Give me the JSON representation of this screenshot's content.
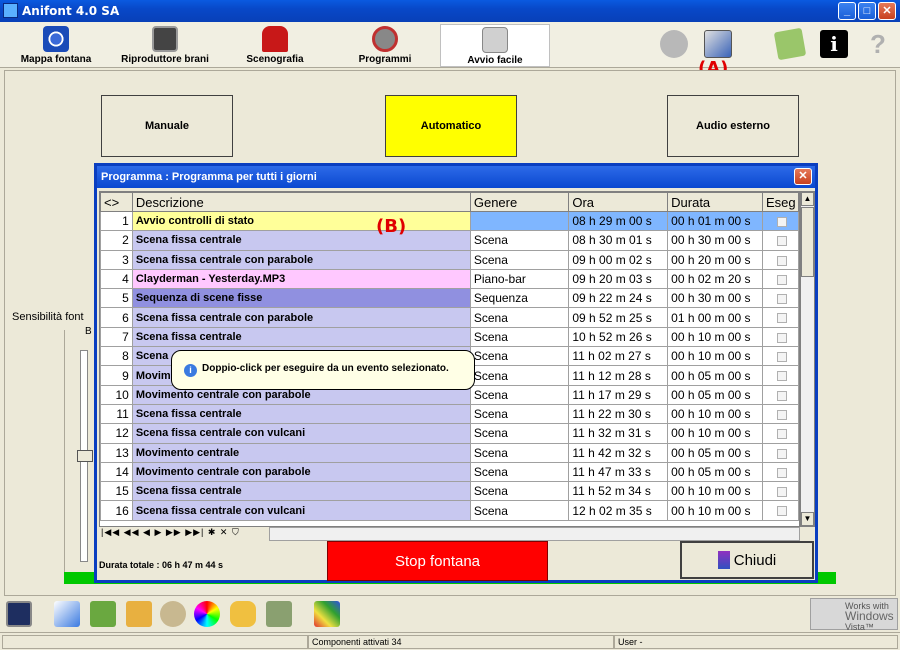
{
  "window": {
    "title": "Anifont 4.0 SA",
    "minimize": "_",
    "maximize": "□",
    "close": "✕"
  },
  "toolbar": {
    "items": [
      {
        "label": "Mappa fontana"
      },
      {
        "label": "Riproduttore brani"
      },
      {
        "label": "Scenografia"
      },
      {
        "label": "Programmi"
      },
      {
        "label": "Avvio facile"
      }
    ],
    "annotation": "(A)"
  },
  "modes": {
    "manual": "Manuale",
    "automatic": "Automatico",
    "external": "Audio esterno"
  },
  "sensitivity": {
    "label": "Sensibilità font",
    "frame_letter": "B"
  },
  "dialog": {
    "title": "Programma : Programma per tutti i giorni",
    "close": "✕",
    "annotation": "(B)",
    "columns": [
      "<>",
      "Descrizione",
      "Genere",
      "Ora",
      "Durata",
      "Eseg"
    ],
    "rows": [
      {
        "n": "1",
        "desc": "Avvio controlli di stato",
        "genre": "",
        "time": "08 h 29 m 00 s",
        "dur": "00 h 01 m 00 s",
        "color": "#ffff99",
        "gcolor": "#7fb6ff"
      },
      {
        "n": "2",
        "desc": "Scena fissa centrale",
        "genre": "Scena",
        "time": "08 h 30 m 01 s",
        "dur": "00 h 30 m 00 s",
        "color": "#c8c8f0",
        "gcolor": "#ffffff"
      },
      {
        "n": "3",
        "desc": "Scena fissa centrale con parabole",
        "genre": "Scena",
        "time": "09 h 00 m 02 s",
        "dur": "00 h 20 m 00 s",
        "color": "#c8c8f0",
        "gcolor": "#ffffff"
      },
      {
        "n": "4",
        "desc": "Clayderman - Yesterday.MP3",
        "genre": "Piano-bar",
        "time": "09 h 20 m 03 s",
        "dur": "00 h 02 m 20 s",
        "color": "#ffc8ff",
        "gcolor": "#ffffff"
      },
      {
        "n": "5",
        "desc": "Sequenza di scene fisse",
        "genre": "Sequenza",
        "time": "09 h 22 m 24 s",
        "dur": "00 h 30 m 00 s",
        "color": "#9090e0",
        "gcolor": "#ffffff"
      },
      {
        "n": "6",
        "desc": "Scena fissa centrale con parabole",
        "genre": "Scena",
        "time": "09 h 52 m 25 s",
        "dur": "01 h 00 m 00 s",
        "color": "#c8c8f0",
        "gcolor": "#ffffff"
      },
      {
        "n": "7",
        "desc": "Scena fissa centrale",
        "genre": "Scena",
        "time": "10 h 52 m 26 s",
        "dur": "00 h 10 m 00 s",
        "color": "#c8c8f0",
        "gcolor": "#ffffff"
      },
      {
        "n": "8",
        "desc": "Scena",
        "genre": "Scena",
        "time": "11 h 02 m 27 s",
        "dur": "00 h 10 m 00 s",
        "color": "#c8c8f0",
        "gcolor": "#ffffff"
      },
      {
        "n": "9",
        "desc": "Movim",
        "genre": "Scena",
        "time": "11 h 12 m 28 s",
        "dur": "00 h 05 m 00 s",
        "color": "#c8c8f0",
        "gcolor": "#ffffff"
      },
      {
        "n": "10",
        "desc": "Movimento centrale con parabole",
        "genre": "Scena",
        "time": "11 h 17 m 29 s",
        "dur": "00 h 05 m 00 s",
        "color": "#c8c8f0",
        "gcolor": "#ffffff"
      },
      {
        "n": "11",
        "desc": "Scena fissa centrale",
        "genre": "Scena",
        "time": "11 h 22 m 30 s",
        "dur": "00 h 10 m 00 s",
        "color": "#c8c8f0",
        "gcolor": "#ffffff"
      },
      {
        "n": "12",
        "desc": "Scena fissa centrale con vulcani",
        "genre": "Scena",
        "time": "11 h 32 m 31 s",
        "dur": "00 h 10 m 00 s",
        "color": "#c8c8f0",
        "gcolor": "#ffffff"
      },
      {
        "n": "13",
        "desc": "Movimento centrale",
        "genre": "Scena",
        "time": "11 h 42 m 32 s",
        "dur": "00 h 05 m 00 s",
        "color": "#c8c8f0",
        "gcolor": "#ffffff"
      },
      {
        "n": "14",
        "desc": "Movimento centrale con parabole",
        "genre": "Scena",
        "time": "11 h 47 m 33 s",
        "dur": "00 h 05 m 00 s",
        "color": "#c8c8f0",
        "gcolor": "#ffffff"
      },
      {
        "n": "15",
        "desc": "Scena fissa centrale",
        "genre": "Scena",
        "time": "11 h 52 m 34 s",
        "dur": "00 h 10 m 00 s",
        "color": "#c8c8f0",
        "gcolor": "#ffffff"
      },
      {
        "n": "16",
        "desc": "Scena fissa centrale con vulcani",
        "genre": "Scena",
        "time": "12 h 02 m 35 s",
        "dur": "00 h 10 m 00 s",
        "color": "#c8c8f0",
        "gcolor": "#ffffff"
      }
    ],
    "tooltip": "Doppio-click per eseguire da un evento selezionato.",
    "nav": "|◀◀ ◀◀ ◀ ▶ ▶▶ ▶▶| ✱ ✕ ⛉",
    "total_duration": "Durata totale : 06 h 47 m 44 s",
    "stop": "Stop fontana",
    "close_button": "Chiudi"
  },
  "branding": {
    "line1": "Works with",
    "line2": "Windows",
    "line3": "Vista™"
  },
  "status": {
    "components": "Componenti attivati 34",
    "user": "User  -"
  },
  "colors": {
    "accent": "#0a48d0",
    "stop": "#ff0000",
    "active_mode": "#ffff00"
  }
}
